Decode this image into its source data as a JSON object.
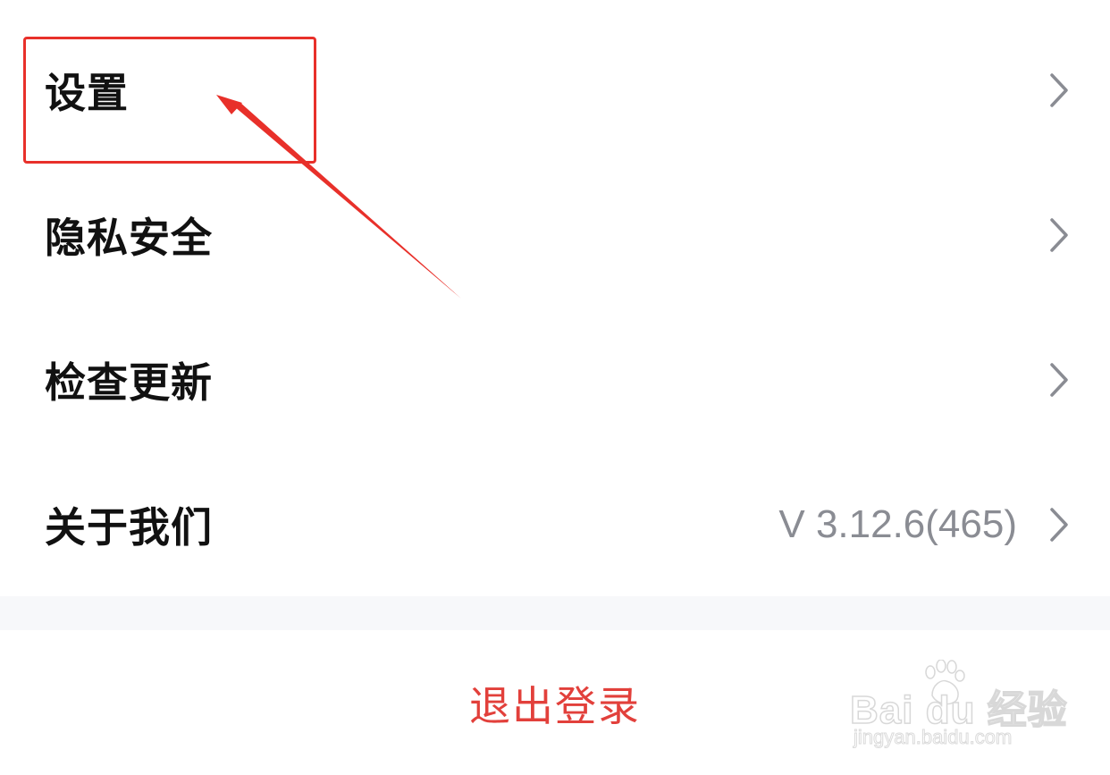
{
  "menu": {
    "items": [
      {
        "label": "设置",
        "value": ""
      },
      {
        "label": "隐私安全",
        "value": ""
      },
      {
        "label": "检查更新",
        "value": ""
      },
      {
        "label": "关于我们",
        "value": "V 3.12.6(465)"
      }
    ]
  },
  "logout": {
    "label": "退出登录"
  },
  "watermark": {
    "logo_text": "Bai  du 经验",
    "url": "jingyan.baidu.com"
  },
  "colors": {
    "logout_text": "#e2403b",
    "annotation": "#e8302a",
    "label_text": "#111111",
    "value_text": "#8a8c93",
    "chevron": "#8a8c93"
  },
  "icons": {
    "chevron": "chevron-right-icon",
    "watermark": "baidu-paw-icon"
  }
}
